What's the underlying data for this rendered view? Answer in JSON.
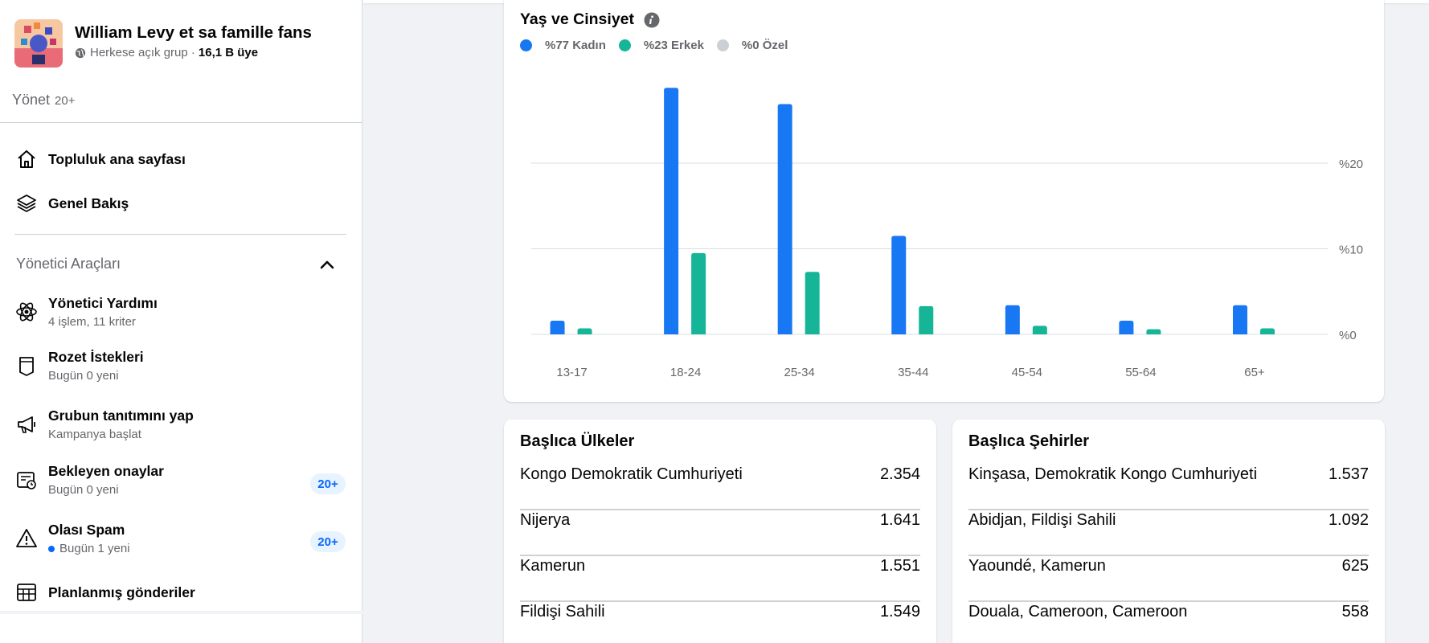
{
  "group": {
    "name": "William Levy et sa famille fans",
    "privacy": "Herkese açık grup ·",
    "members": "16,1 B üye"
  },
  "manage": {
    "label": "Yönet",
    "count": "20+"
  },
  "nav": {
    "community_home": "Topluluk ana sayfası",
    "overview": "Genel Bakış"
  },
  "admin_tools": {
    "title": "Yönetici Araçları",
    "items": [
      {
        "label": "Yönetici Yardımı",
        "sub": "4 işlem, 11 kriter",
        "icon": "admin-assist-icon"
      },
      {
        "label": "Rozet İstekleri",
        "sub": "Bugün 0 yeni",
        "icon": "badge-icon"
      },
      {
        "label": "Grubun tanıtımını yap",
        "sub": "Kampanya başlat",
        "icon": "megaphone-icon"
      },
      {
        "label": "Bekleyen onaylar",
        "sub": "Bugün 0 yeni",
        "badge": "20+",
        "icon": "pending-icon"
      },
      {
        "label": "Olası Spam",
        "sub": "Bugün 1 yeni",
        "badge": "20+",
        "icon": "warning-icon"
      },
      {
        "label": "Planlanmış gönderiler",
        "icon": "calendar-icon"
      }
    ]
  },
  "chart_card": {
    "title": "Yaş ve Cinsiyet",
    "legend": [
      {
        "label": "%77 Kadın",
        "color": "#1877f2"
      },
      {
        "label": "%23 Erkek",
        "color": "#16b597"
      },
      {
        "label": "%0 Özel",
        "color": "#ccd0d5"
      }
    ]
  },
  "chart_data": {
    "type": "bar",
    "categories": [
      "13-17",
      "18-24",
      "25-34",
      "35-44",
      "45-54",
      "55-64",
      "65+"
    ],
    "series": [
      {
        "name": "Kadın",
        "color": "#1877f2",
        "values": [
          1.6,
          28.8,
          26.9,
          11.5,
          3.4,
          1.6,
          3.4
        ]
      },
      {
        "name": "Erkek",
        "color": "#16b597",
        "values": [
          0.7,
          9.5,
          7.3,
          3.3,
          1.0,
          0.6,
          0.7
        ]
      }
    ],
    "ytick_labels": [
      "%0",
      "%10",
      "%20"
    ],
    "yticks": [
      0,
      10,
      20
    ],
    "ylim": [
      0,
      30
    ],
    "grid": true
  },
  "countries": {
    "title": "Başlıca Ülkeler",
    "rows": [
      {
        "name": "Kongo Demokratik Cumhuriyeti",
        "value": "2.354"
      },
      {
        "name": "Nijerya",
        "value": "1.641"
      },
      {
        "name": "Kamerun",
        "value": "1.551"
      },
      {
        "name": "Fildişi Sahili",
        "value": "1.549"
      }
    ]
  },
  "cities": {
    "title": "Başlıca Şehirler",
    "rows": [
      {
        "name": "Kinşasa, Demokratik Kongo Cumhuriyeti",
        "value": "1.537"
      },
      {
        "name": "Abidjan, Fildişi Sahili",
        "value": "1.092"
      },
      {
        "name": "Yaoundé, Kamerun",
        "value": "625"
      },
      {
        "name": "Douala, Cameroon, Cameroon",
        "value": "558"
      }
    ]
  }
}
